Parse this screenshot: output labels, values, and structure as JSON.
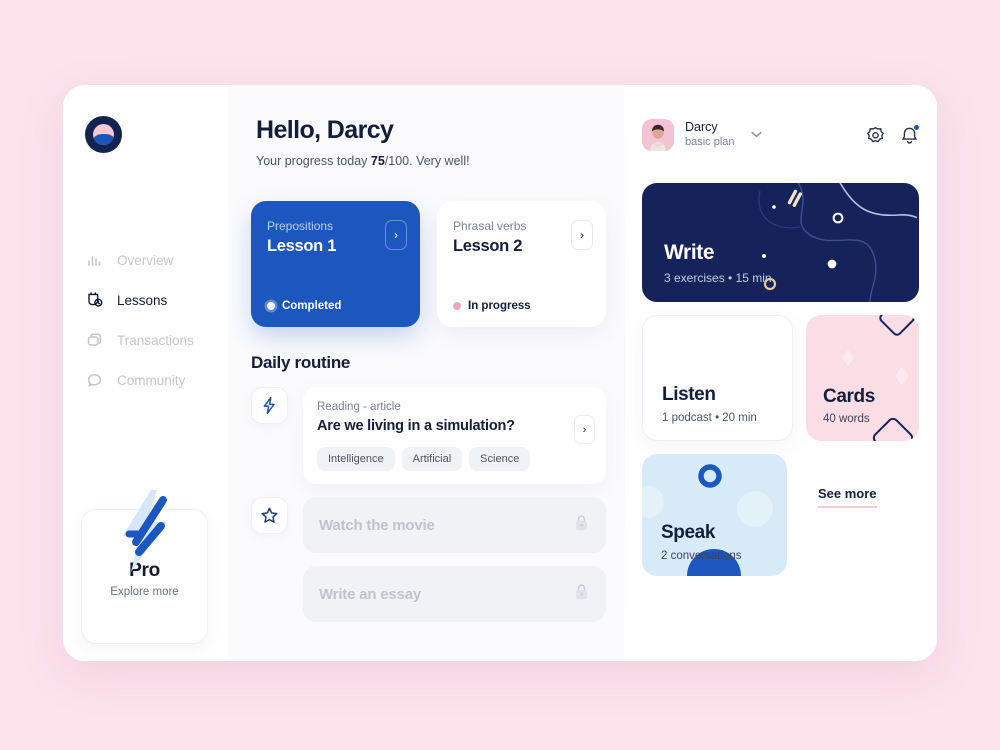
{
  "brand": {
    "logo_name": "app-logo",
    "accent_blue": "#1C56BF",
    "navy": "#16235A",
    "pink_bg": "#FCE3EC"
  },
  "sidebar": {
    "items": [
      {
        "label": "Overview",
        "icon": "bar-chart-icon",
        "active": false
      },
      {
        "label": "Lessons",
        "icon": "lessons-icon",
        "active": true
      },
      {
        "label": "Transactions",
        "icon": "transactions-icon",
        "active": false
      },
      {
        "label": "Community",
        "icon": "chat-bubble-icon",
        "active": false
      }
    ],
    "pro": {
      "title": "Pro",
      "subtitle": "Explore more",
      "icon": "lightning-bolt-icon"
    }
  },
  "greeting": {
    "title": "Hello, Darcy",
    "progress_prefix": "Your progress today ",
    "progress_value": "75",
    "progress_suffix": "/100. Very well!"
  },
  "lessons": [
    {
      "topic": "Prepositions",
      "title": "Lesson 1",
      "status": "Completed",
      "state": "completed",
      "arrow": "›"
    },
    {
      "topic": "Phrasal verbs",
      "title": "Lesson 2",
      "status": "In progress",
      "state": "inprogress",
      "arrow": "›"
    }
  ],
  "routine": {
    "section_title": "Daily routine",
    "article": {
      "icon": "lightning-bolt-icon",
      "kicker": "Reading - article",
      "title": "Are we living in a simulation?",
      "tags": [
        "Intelligence",
        "Artificial",
        "Science"
      ],
      "arrow": "›"
    },
    "locked_items": [
      {
        "icon": "star-icon",
        "label": "Watch the movie",
        "lock": "lock-icon"
      },
      {
        "icon": "",
        "label": "Write an essay",
        "lock": "lock-icon"
      }
    ]
  },
  "user": {
    "name": "Darcy",
    "plan": "basic plan",
    "chevron": "⌄",
    "avatar_name": "user-avatar",
    "settings_icon": "gear-icon",
    "notifications_icon": "bell-icon"
  },
  "skill_cards": {
    "write": {
      "title": "Write",
      "meta": "3 exercises  •  15 min"
    },
    "listen": {
      "title": "Listen",
      "meta": "1 podcast  •  20 min"
    },
    "cards": {
      "title": "Cards",
      "meta": "40 words"
    },
    "speak": {
      "title": "Speak",
      "meta": "2 conversations"
    },
    "see_more": "See more"
  }
}
